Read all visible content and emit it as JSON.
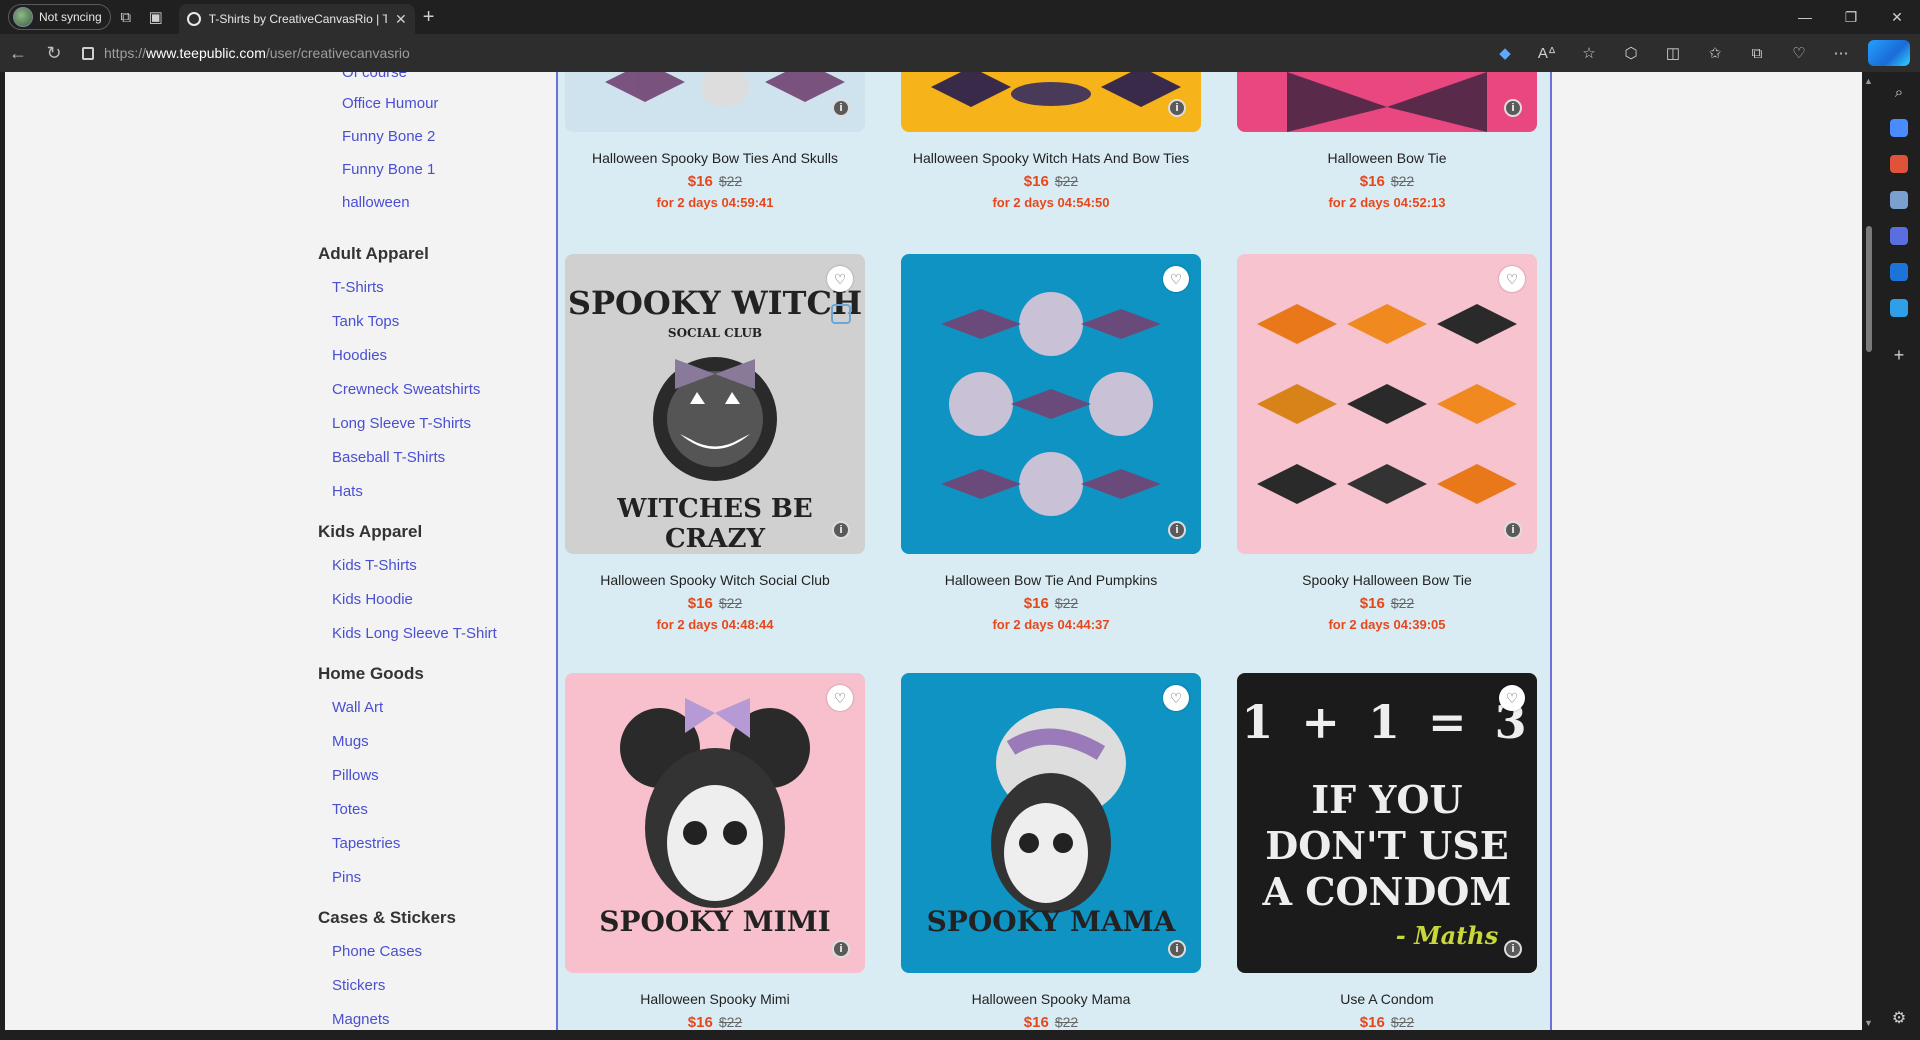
{
  "browser": {
    "profile_label": "Not syncing",
    "tab_title": "T-Shirts by CreativeCanvasRio | T",
    "url_prefix": "https://",
    "url_host": "www.teepublic.com",
    "url_path": "/user/creativecanvasrio"
  },
  "sidebar": {
    "subcategories": [
      {
        "label": "Of course"
      },
      {
        "label": "Office Humour"
      },
      {
        "label": "Funny Bone 2"
      },
      {
        "label": "Funny Bone 1"
      },
      {
        "label": "halloween"
      }
    ],
    "sections": [
      {
        "title": "Adult Apparel",
        "items": [
          "T-Shirts",
          "Tank Tops",
          "Hoodies",
          "Crewneck Sweatshirts",
          "Long Sleeve T-Shirts",
          "Baseball T-Shirts",
          "Hats"
        ]
      },
      {
        "title": "Kids Apparel",
        "items": [
          "Kids T-Shirts",
          "Kids Hoodie",
          "Kids Long Sleeve T-Shirt"
        ]
      },
      {
        "title": "Home Goods",
        "items": [
          "Wall Art",
          "Mugs",
          "Pillows",
          "Totes",
          "Tapestries",
          "Pins"
        ]
      },
      {
        "title": "Cases & Stickers",
        "items": [
          "Phone Cases",
          "Stickers",
          "Magnets"
        ]
      }
    ]
  },
  "products": [
    {
      "name": "Halloween Spooky Bow Ties And Skulls",
      "price": "$16",
      "old_price": "$22",
      "timer": "for 2 days 04:59:41",
      "bg": "#cfe3ef"
    },
    {
      "name": "Halloween Spooky Witch Hats And Bow Ties",
      "price": "$16",
      "old_price": "$22",
      "timer": "for 2 days 04:54:50",
      "bg": "#f7b31a"
    },
    {
      "name": "Halloween Bow Tie",
      "price": "$16",
      "old_price": "$22",
      "timer": "for 2 days 04:52:13",
      "bg": "#e8477f"
    },
    {
      "name": "Halloween Spooky Witch Social Club",
      "price": "$16",
      "old_price": "$22",
      "timer": "for 2 days 04:48:44",
      "bg": "#d0d0d0",
      "art_top": "SPOOKY WITCH",
      "art_mid": "SOCIAL CLUB",
      "art_bottom": "WITCHES BE CRAZY"
    },
    {
      "name": "Halloween Bow Tie And Pumpkins",
      "price": "$16",
      "old_price": "$22",
      "timer": "for 2 days 04:44:37",
      "bg": "#0f93c2"
    },
    {
      "name": "Spooky Halloween Bow Tie",
      "price": "$16",
      "old_price": "$22",
      "timer": "for 2 days 04:39:05",
      "bg": "#f7c3cf"
    },
    {
      "name": "Halloween Spooky Mimi",
      "price": "$16",
      "old_price": "$22",
      "timer": "",
      "bg": "#f7c0cc",
      "art_bottom": "SPOOKY MIMI"
    },
    {
      "name": "Halloween Spooky Mama",
      "price": "$16",
      "old_price": "$22",
      "timer": "",
      "bg": "#0f93c2",
      "art_bottom": "SPOOKY MAMA"
    },
    {
      "name": "Use A Condom",
      "price": "$16",
      "old_price": "$22",
      "timer": "",
      "bg": "#1b1b1b",
      "art_line1": "1 + 1 = 3",
      "art_line2": "IF YOU",
      "art_line3": "DON'T USE",
      "art_line4": "A CONDOM",
      "art_sig": "- Maths"
    }
  ]
}
